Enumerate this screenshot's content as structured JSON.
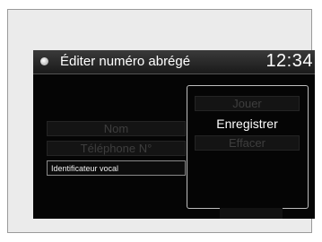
{
  "header": {
    "icon": "home-menu-icon",
    "title": "Éditer numéro abrégé",
    "clock": "12:34"
  },
  "fields": [
    {
      "label": "Nom",
      "state": "disabled"
    },
    {
      "label": "Téléphone N°",
      "state": "disabled"
    },
    {
      "label": "Identificateur vocal",
      "state": "active"
    }
  ],
  "options": [
    {
      "label": "Jouer",
      "state": "disabled"
    },
    {
      "label": "Enregistrer",
      "state": "selected"
    },
    {
      "label": "Effacer",
      "state": "disabled"
    }
  ],
  "colors": {
    "screen_bg": "#050505",
    "frame_bg": "#ebebeb",
    "text_active": "#ffffff",
    "text_disabled": "#3e3e3e"
  }
}
